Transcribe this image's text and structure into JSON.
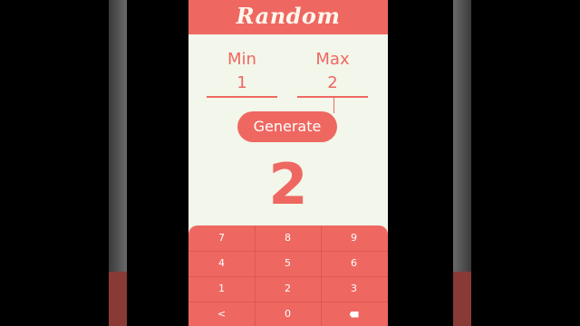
{
  "app": {
    "title": "Random"
  },
  "range": {
    "min_label": "Min",
    "max_label": "Max",
    "min_value": "1",
    "max_value": "2"
  },
  "actions": {
    "generate_label": "Generate"
  },
  "result": {
    "value": "2"
  },
  "keypad": {
    "row1": [
      "7",
      "8",
      "9"
    ],
    "row2": [
      "4",
      "5",
      "6"
    ],
    "row3": [
      "1",
      "2",
      "3"
    ],
    "row4": [
      "<",
      "0",
      "backspace"
    ]
  },
  "colors": {
    "accent": "#ee6861",
    "background": "#f3f6ea",
    "header_text": "#fff7ee"
  }
}
